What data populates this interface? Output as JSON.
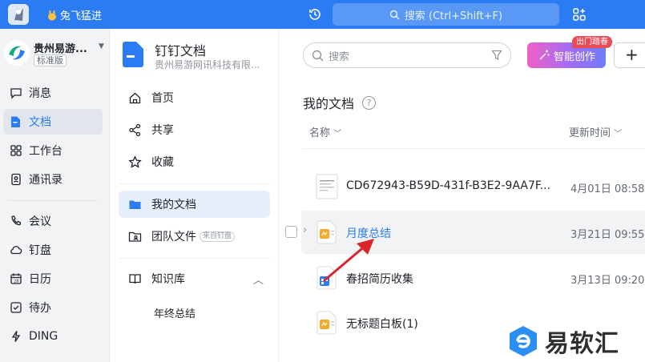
{
  "topbar": {
    "user_tag": "兔飞猛进",
    "search_placeholder": "搜索 (Ctrl+Shift+F)"
  },
  "nav": {
    "org_name": "贵州易游...",
    "org_badge": "标准版",
    "items": [
      {
        "label": "消息"
      },
      {
        "label": "文档"
      },
      {
        "label": "工作台"
      },
      {
        "label": "通讯录"
      },
      {
        "label": "会议"
      },
      {
        "label": "钉盘"
      },
      {
        "label": "日历"
      },
      {
        "label": "待办"
      },
      {
        "label": "DING"
      }
    ]
  },
  "docnav": {
    "title": "钉钉文档",
    "subtitle": "贵州易游网讯科技有限...",
    "items": [
      {
        "label": "首页"
      },
      {
        "label": "共享"
      },
      {
        "label": "收藏"
      },
      {
        "label": "我的文档"
      },
      {
        "label": "团队文件",
        "badge": "来自钉盘"
      },
      {
        "label": "知识库"
      }
    ],
    "kb_subitem": "年终总结"
  },
  "main": {
    "search_placeholder": "搜索",
    "smart_button": "智能创作",
    "smart_badge": "出门踏春",
    "new_button": "+",
    "section_title": "我的文档",
    "help": "?",
    "col_name": "名称",
    "col_time": "更新时间",
    "rows": [
      {
        "name": "CD672943-B59D-431f-B3E2-9AA7F...",
        "time": "4月01日 08:58"
      },
      {
        "name": "月度总结",
        "time": "3月21日 09:55"
      },
      {
        "name": "春招简历收集",
        "time": "3月13日 09:20"
      },
      {
        "name": "无标题白板(1)",
        "time": ""
      }
    ]
  },
  "watermark": {
    "text": "易软汇"
  },
  "colors": {
    "brand": "#2b7bf3",
    "arrow": "#d9252b"
  }
}
